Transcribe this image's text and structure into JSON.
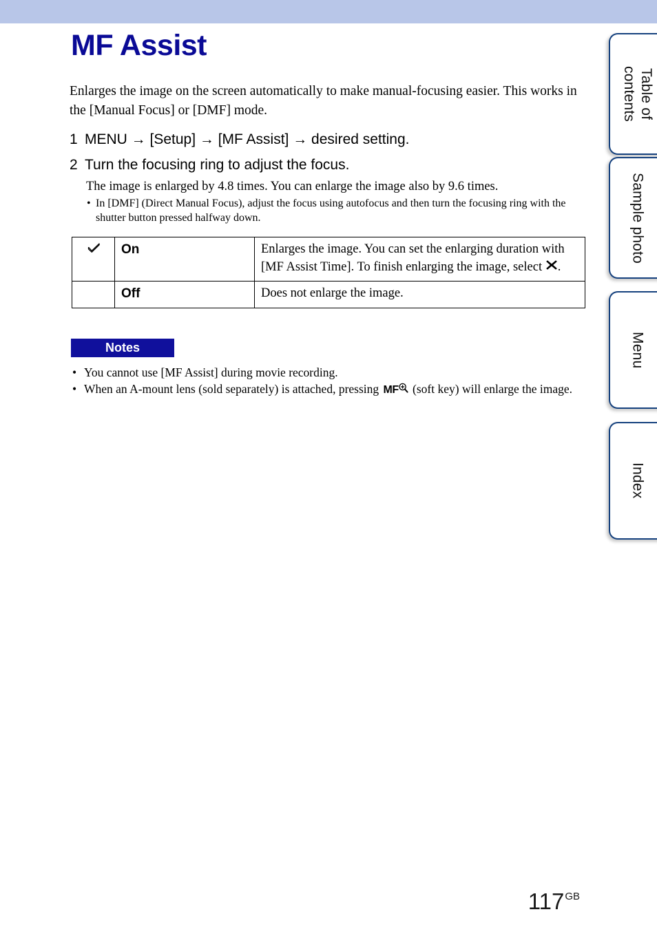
{
  "page": {
    "title": "MF Assist",
    "number": "117",
    "number_suffix": "GB",
    "band_color": "#b8c6e8",
    "title_color": "#0a0a96"
  },
  "intro": "Enlarges the image on the screen automatically to make manual-focusing easier. This works in the [Manual Focus] or [DMF] mode.",
  "steps": [
    {
      "num": "1",
      "text": "MENU → [Setup] → [MF Assist] → desired setting."
    },
    {
      "num": "2",
      "text": "Turn the focusing ring to adjust the focus.",
      "body": "The image is enlarged by 4.8 times. You can enlarge the image also by 9.6 times.",
      "bullet": "In [DMF] (Direct Manual Focus), adjust the focus using autofocus and then turn the focusing ring with the shutter button pressed halfway down."
    }
  ],
  "settings_table": {
    "rows": [
      {
        "checked": true,
        "check_icon": "checkmark-icon",
        "name": "On",
        "description_before": "Enlarges the image. You can set the enlarging duration with [MF Assist Time]. To finish enlarging the image, select",
        "inline_icon": "cross-x-icon",
        "description_after": "."
      },
      {
        "checked": false,
        "check_icon": "",
        "name": "Off",
        "description_before": "Does not enlarge the image.",
        "inline_icon": "",
        "description_after": ""
      }
    ]
  },
  "notes": {
    "badge_label": "Notes",
    "badge_color": "#10109c",
    "items": [
      {
        "text_before": "You cannot use [MF Assist] during movie recording.",
        "icon": "",
        "text_after": ""
      },
      {
        "text_before": "When an A-mount lens (sold separately) is attached, pressing",
        "icon": "mf-magnify-icon",
        "icon_text": "MF",
        "text_after": "(soft key) will enlarge the image."
      }
    ]
  },
  "tabs": [
    {
      "label": "Table of\ncontents",
      "name": "tab-table-of-contents"
    },
    {
      "label": "Sample photo",
      "name": "tab-sample-photo"
    },
    {
      "label": "Menu",
      "name": "tab-menu"
    },
    {
      "label": "Index",
      "name": "tab-index"
    }
  ]
}
